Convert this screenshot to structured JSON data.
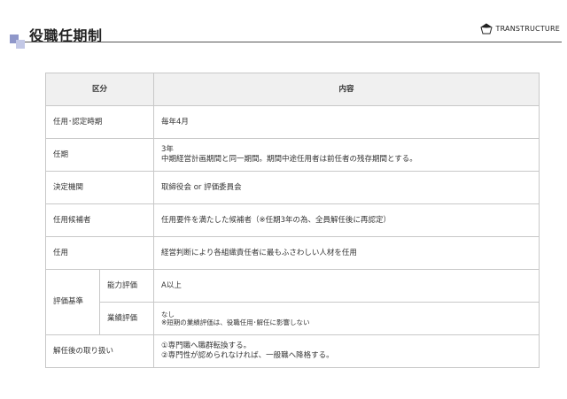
{
  "page": {
    "title": "役職任期制",
    "logo_text": "TRANSTRUCTURE",
    "logo_icon": "pentagon-logo-icon",
    "accent_color": "#8f97c9"
  },
  "table": {
    "headers": [
      "区分",
      "内容"
    ],
    "rows": {
      "appointment_timing": {
        "label": "任用･認定時期",
        "content": "毎年4月"
      },
      "term": {
        "label": "任期",
        "content_line1": "3年",
        "content_line2": "中期経営計画期間と同一期間。期間中途任用者は前任者の残存期間とする。"
      },
      "decision_body": {
        "label": "決定機関",
        "content": "取締役会 or 評価委員会"
      },
      "candidates": {
        "label": "任用候補者",
        "content": "任用要件を満たした候補者（※任期3年の為、全員解任後に再認定）"
      },
      "appointment": {
        "label": "任用",
        "content": "経営判断により各組織責任者に最もふさわしい人材を任用"
      },
      "criteria": {
        "label": "評価基準",
        "ability_label": "能力評価",
        "ability_content": "A以上",
        "performance_label": "業績評価",
        "performance_line1": "なし",
        "performance_line2": "※短期の業績評価は、役職任用･解任に影響しない"
      },
      "after_dismissal": {
        "label": "解任後の取り扱い",
        "content_line1": "①専門職へ職群転換する。",
        "content_line2": "②専門性が認められなければ、一般職へ降格する。"
      }
    }
  }
}
